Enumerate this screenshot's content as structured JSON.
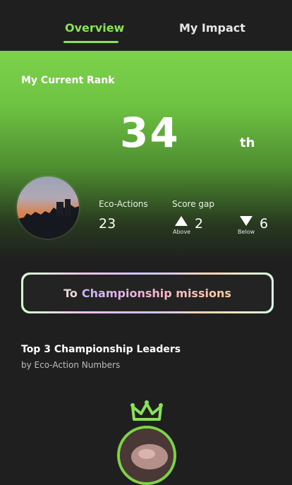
{
  "tabs": {
    "overview_label": "Overview",
    "impact_label": "My Impact",
    "active": "Overview"
  },
  "rank": {
    "title": "My Current Rank",
    "number": "34",
    "suffix": "th"
  },
  "stats": {
    "eco_actions_label": "Eco-Actions",
    "eco_actions_value": "23",
    "score_gap_label": "Score gap",
    "above_label": "Above",
    "above_value": "2",
    "below_label": "Below",
    "below_value": "6"
  },
  "cta": {
    "prefix": "To",
    "label": "Championship missions"
  },
  "leaders": {
    "title": "Top 3 Championship Leaders",
    "subtitle": "by Eco-Action Numbers"
  },
  "icons": {
    "crown": "crown-icon",
    "arrow_up": "triangle-up-icon",
    "arrow_down": "triangle-down-icon"
  },
  "colors": {
    "accent": "#8be05a",
    "background": "#1f1f1f",
    "hero_top": "#7dd24a"
  }
}
